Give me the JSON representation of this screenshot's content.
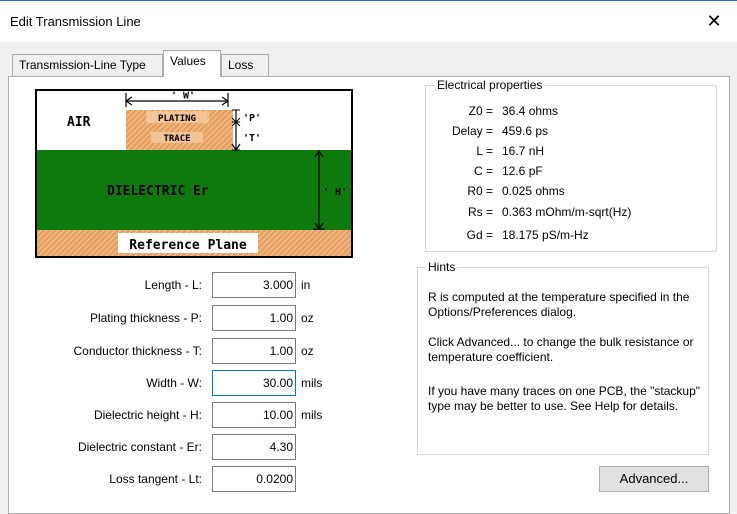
{
  "window": {
    "title": "Edit Transmission Line",
    "close_icon": "close-icon"
  },
  "tabs": [
    {
      "label": "Transmission-Line Type",
      "active": false
    },
    {
      "label": "Values",
      "active": true
    },
    {
      "label": "Loss",
      "active": false
    }
  ],
  "diagram": {
    "air": "AIR",
    "width": "' W'",
    "plating": "PLATING",
    "trace": "TRACE",
    "p": "'P'",
    "t": "'T'",
    "dielectric": "DIELECTRIC  Er",
    "h": "' H'",
    "reference_plane": "Reference Plane",
    "colors": {
      "dielectric": "#0e7a0e",
      "copper": "#e8a060",
      "border": "#000000"
    }
  },
  "electrical": {
    "title": "Electrical properties",
    "rows": [
      {
        "label": "Z0 =",
        "value": "36.4 ohms"
      },
      {
        "label": "Delay =",
        "value": "459.6 ps"
      },
      {
        "label": "L =",
        "value": "16.7 nH"
      },
      {
        "label": "C =",
        "value": "12.6 pF"
      },
      {
        "label": "R0 =",
        "value": "0.025 ohms"
      },
      {
        "label": "Rs =",
        "value": "0.363 mOhm/m-sqrt(Hz)"
      },
      {
        "label": "Gd =",
        "value": "18.175 pS/m-Hz"
      }
    ]
  },
  "hints": {
    "title": "Hints",
    "paragraphs": [
      "R is computed at the temperature specified in the Options/Preferences dialog.",
      "Click Advanced... to change the bulk resistance or temperature coefficient.",
      "If you have many traces on one PCB, the \"stackup\" type may be better to use.  See Help for details."
    ]
  },
  "fields": [
    {
      "label": "Length - L:",
      "value": "3.000",
      "unit": "in"
    },
    {
      "label": "Plating thickness - P:",
      "value": "1.00",
      "unit": "oz"
    },
    {
      "label": "Conductor thickness - T:",
      "value": "1.00",
      "unit": "oz"
    },
    {
      "label": "Width - W:",
      "value": "30.00",
      "unit": "mils"
    },
    {
      "label": "Dielectric height - H:",
      "value": "10.00",
      "unit": "mils"
    },
    {
      "label": "Dielectric constant - Er:",
      "value": "4.30",
      "unit": ""
    },
    {
      "label": "Loss tangent - Lt:",
      "value": "0.0200",
      "unit": ""
    }
  ],
  "advanced_button": "Advanced..."
}
